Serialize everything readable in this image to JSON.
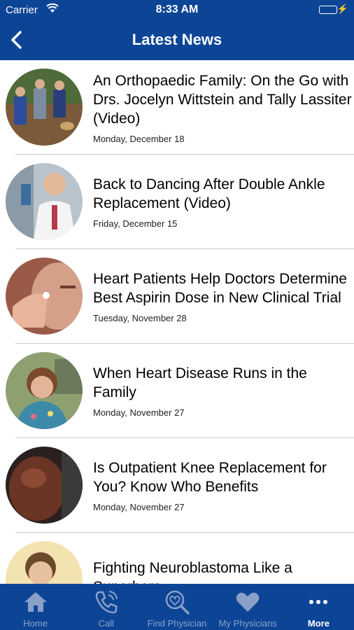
{
  "status_bar": {
    "carrier": "Carrier",
    "time": "8:33 AM",
    "battery_level": 1.0
  },
  "nav": {
    "title": "Latest News",
    "back_icon": "chevron-left-icon"
  },
  "news": [
    {
      "headline": "An Orthopaedic Family: On the Go with Drs. Jocelyn Wittstein and Tally Lassiter (Video)",
      "date": "Monday, December 18"
    },
    {
      "headline": "Back to Dancing After Double Ankle Replacement (Video)",
      "date": "Friday, December 15"
    },
    {
      "headline": "Heart Patients Help Doctors Determine Best Aspirin Dose in New Clinical Trial",
      "date": "Tuesday, November 28"
    },
    {
      "headline": "When Heart Disease Runs in the Family",
      "date": "Monday, November 27"
    },
    {
      "headline": "Is Outpatient Knee Replacement for You? Know Who Benefits",
      "date": "Monday, November 27"
    },
    {
      "headline": "Fighting Neuroblastoma Like a Superhero",
      "date": ""
    }
  ],
  "tabs": [
    {
      "label": "Home",
      "icon": "home-icon"
    },
    {
      "label": "Call",
      "icon": "phone-icon"
    },
    {
      "label": "Find Physician",
      "icon": "search-icon"
    },
    {
      "label": "My Physicians",
      "icon": "heart-icon"
    },
    {
      "label": "More",
      "icon": "more-icon"
    }
  ],
  "colors": {
    "brand_blue": "#0d4596",
    "tab_inactive": "#8aa0c8",
    "tab_active": "#ffffff",
    "battery_green": "#4cd964"
  }
}
